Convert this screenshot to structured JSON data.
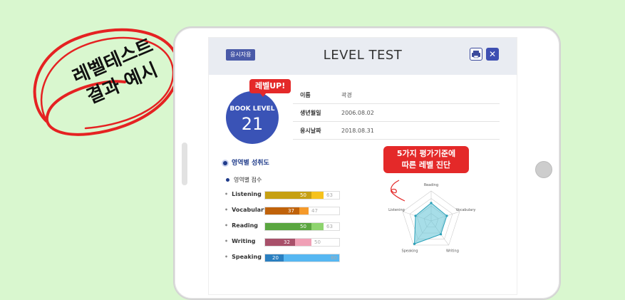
{
  "callout": {
    "line1": "레벨테스트",
    "line2": "결과 예시"
  },
  "header": {
    "badge": "응시자용",
    "title": "LEVEL TEST",
    "print_icon": "printer-icon",
    "close_icon": "close-icon"
  },
  "level": {
    "label": "BOOK LEVEL",
    "value": "21",
    "tag": "레벨UP!"
  },
  "info": [
    {
      "k": "이름",
      "v": "곽경"
    },
    {
      "k": "생년월일",
      "v": "2006.08.02"
    },
    {
      "k": "응시날짜",
      "v": "2018.08.31"
    }
  ],
  "section": {
    "title": "영역별 성취도",
    "sub": "영역별 점수"
  },
  "scores": [
    {
      "label": "Listening",
      "score": 50,
      "avg": 63,
      "color": "#c6a012",
      "avgcolor": "#f6c21c"
    },
    {
      "label": "Vocabulary",
      "score": 37,
      "avg": 47,
      "color": "#c0620a",
      "avgcolor": "#f59a2a"
    },
    {
      "label": "Reading",
      "score": 50,
      "avg": 63,
      "color": "#5aa640",
      "avgcolor": "#8ed46e"
    },
    {
      "label": "Writing",
      "score": 32,
      "avg": 50,
      "color": "#a8506a",
      "avgcolor": "#f0a0b6"
    },
    {
      "label": "Speaking",
      "score": 20,
      "avg": 80,
      "color": "#2a7fc0",
      "avgcolor": "#56b7f2"
    }
  ],
  "bar_max": 80,
  "radar_note": {
    "line1": "5가지 평가기준에",
    "line2": "따른 레벨 진단"
  },
  "radar": {
    "axes": [
      "Reading",
      "Vocabulary",
      "Writing",
      "Speaking",
      "Listening"
    ],
    "values": [
      0.6,
      0.55,
      0.55,
      0.95,
      0.55
    ]
  }
}
